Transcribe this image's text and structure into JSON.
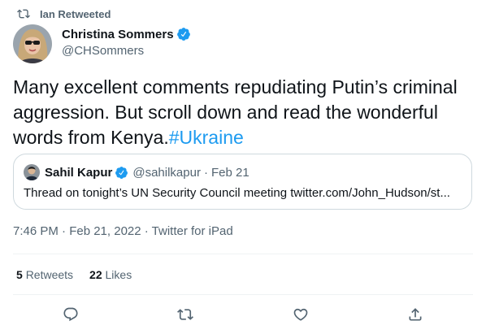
{
  "retweet_context": {
    "label": "Ian Retweeted",
    "icon": "retweet-icon"
  },
  "author": {
    "name": "Christina Sommers",
    "handle": "@CHSommers",
    "verified_icon": "verified-badge-icon"
  },
  "tweet": {
    "text": "Many excellent comments repudiating Putin’s criminal aggression. But scroll down and read the wonderful words from Kenya.",
    "hashtag": "#Ukraine"
  },
  "quote": {
    "name": "Sahil Kapur",
    "handle": "@sahilkapur",
    "separator": "·",
    "date": "Feb 21",
    "text": "Thread on tonight’s UN Security Council meeting twitter.com/John_Hudson/st..."
  },
  "meta": {
    "timestamp": "7:46 PM · Feb 21, 2022 · Twitter for iPad"
  },
  "stats": {
    "retweets_count": "5",
    "retweets_label": "Retweets",
    "likes_count": "22",
    "likes_label": "Likes"
  },
  "actions": [
    "reply-icon",
    "retweet-icon",
    "like-icon",
    "share-icon"
  ],
  "colors": {
    "accent": "#1d9bf0",
    "secondary_text": "#536471",
    "border": "#cfd9de"
  }
}
